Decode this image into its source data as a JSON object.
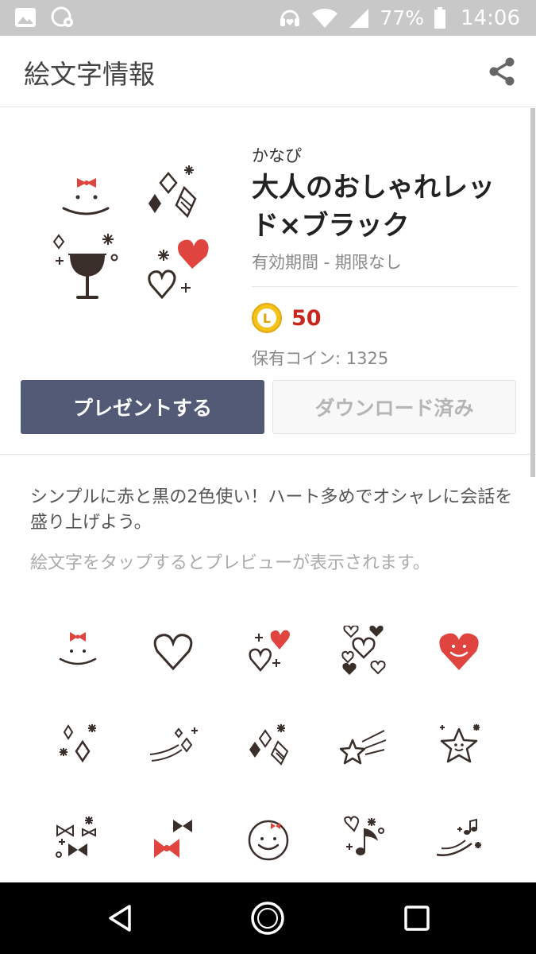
{
  "status_bar": {
    "battery": "77%",
    "time": "14:06",
    "icons": [
      "image-icon",
      "cloud-settings-icon",
      "headset-heart-icon",
      "wifi-icon",
      "signal-icon",
      "battery-icon"
    ]
  },
  "app_bar": {
    "title": "絵文字情報",
    "share_icon": "share-icon"
  },
  "product": {
    "author": "かなぴ",
    "title": "大人のおしゃれレッド×ブラック",
    "validity": "有効期間 - 期限なし",
    "coin_label": "L",
    "price": "50",
    "owned_coins": "保有コイン: 1325",
    "present_button": "プレゼントする",
    "downloaded_button": "ダウンロード済み"
  },
  "description": "シンプルに赤と黒の2色使い！ハート多めでオシャレに会話を盛り上げよう。",
  "hint": "絵文字をタップするとプレビューが表示されます。",
  "emojis": [
    "smile-ribbon-emoji",
    "heart-outline-emoji",
    "hearts-sparkle-emoji",
    "hearts-cluster-emoji",
    "red-heart-face-emoji",
    "sparkle-diamonds-emoji",
    "shooting-sparkles-emoji",
    "diamonds-sparkle-emoji",
    "shooting-star-emoji",
    "star-face-emoji",
    "ribbons-sparkle-emoji",
    "red-black-ribbons-emoji",
    "smiley-face-emoji",
    "music-note-emoji",
    "music-swoosh-emoji"
  ],
  "colors": {
    "accent_red": "#e0443e",
    "ink": "#3a2e2a",
    "present_button_bg": "#525a76",
    "price_red": "#c8281e",
    "coin_gold": "#f4c21a"
  }
}
